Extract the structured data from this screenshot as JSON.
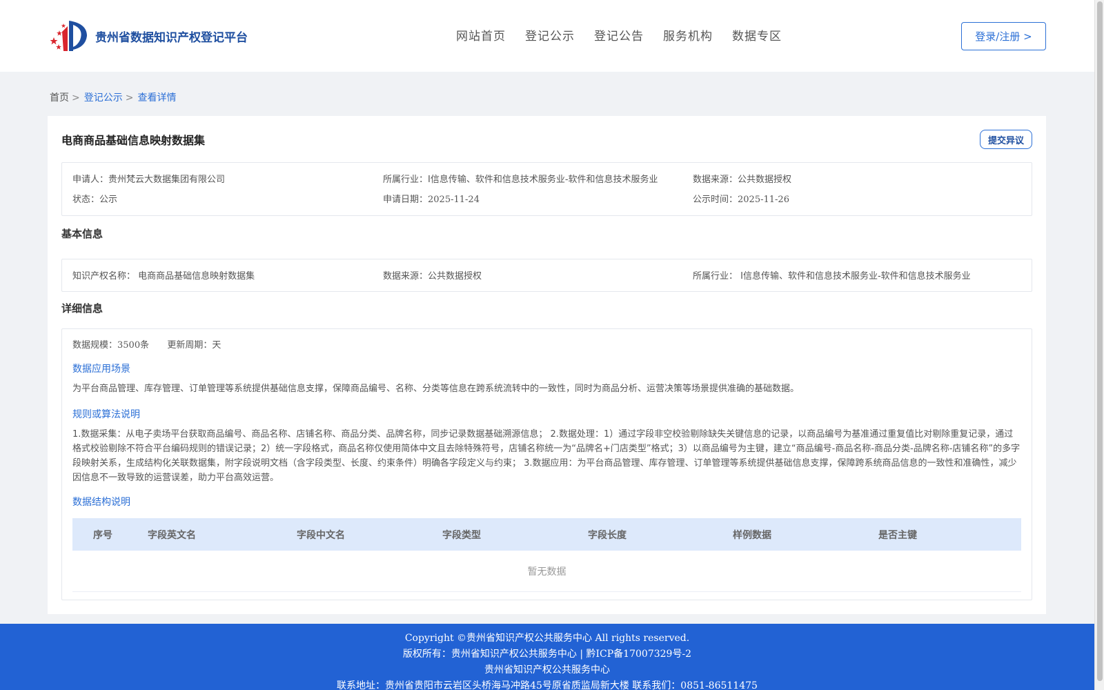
{
  "header": {
    "logo_text": "贵州省数据知识产权登记平台",
    "nav": [
      "网站首页",
      "登记公示",
      "登记公告",
      "服务机构",
      "数据专区"
    ],
    "login_label": "登录/注册 >"
  },
  "breadcrumb": {
    "home": "首页",
    "sep": ">",
    "items": [
      "登记公示",
      "查看详情"
    ]
  },
  "detail": {
    "title": "电商商品基础信息映射数据集",
    "objection_label": "提交异议",
    "summary": {
      "applicant_label": "申请人：",
      "applicant": "贵州梵云大数据集团有限公司",
      "industry_label": "所属行业：",
      "industry": "I信息传输、软件和信息技术服务业-软件和信息技术服务业",
      "source_label": "数据来源：",
      "source": "公共数据授权",
      "status_label": "状态：",
      "status": "公示",
      "apply_date_label": "申请日期：",
      "apply_date": "2025-11-24",
      "publish_label": "公示时间：",
      "publish_date": "2025-11-26"
    },
    "basic": {
      "heading": "基本信息",
      "ip_name_label": "知识产权名称：",
      "ip_name": "电商商品基础信息映射数据集",
      "source_label": "数据来源：",
      "source": "公共数据授权",
      "industry_label": "所属行业：",
      "industry": "I信息传输、软件和信息技术服务业-软件和信息技术服务业"
    },
    "details": {
      "heading": "详细信息",
      "scale_label": "数据规模：",
      "scale": "3500条",
      "cycle_label": "更新周期：",
      "cycle": "天",
      "scenario_heading": "数据应用场景",
      "scenario_text": "为平台商品管理、库存管理、订单管理等系统提供基础信息支撑，保障商品编号、名称、分类等信息在跨系统流转中的一致性，同时为商品分析、运营决策等场景提供准确的基础数据。",
      "rules_heading": "规则或算法说明",
      "rules_text": "1.数据采集：从电子卖场平台获取商品编号、商品名称、店铺名称、商品分类、品牌名称，同步记录数据基础溯源信息； 2.数据处理：1）通过字段非空校验剔除缺失关键信息的记录，以商品编号为基准通过重复值比对剔除重复记录，通过格式校验剔除不符合平台编码规则的错误记录；2）统一字段格式，商品名称仅使用简体中文且去除特殊符号，店铺名称统一为“品牌名+门店类型”格式；3）以商品编号为主键，建立“商品编号-商品名称-商品分类-品牌名称-店铺名称”的多字段映射关系，生成结构化关联数据集，附字段说明文档（含字段类型、长度、约束条件）明确各字段定义与约束； 3.数据应用：为平台商品管理、库存管理、订单管理等系统提供基础信息支撑，保障跨系统商品信息的一致性和准确性，减少因信息不一致导致的运营误差，助力平台高效运营。",
      "structure_heading": "数据结构说明",
      "table_headers": [
        "序号",
        "字段英文名",
        "字段中文名",
        "字段类型",
        "字段长度",
        "样例数据",
        "是否主键"
      ],
      "empty_text": "暂无数据"
    }
  },
  "footer": {
    "line1": "Copyright ©贵州省知识产权公共服务中心 All rights reserved.",
    "line2": "版权所有：贵州省知识产权公共服务中心 | 黔ICP备17007329号-2",
    "line3": "贵州省知识产权公共服务中心",
    "line4": "联系地址：贵州省贵阳市云岩区头桥海马冲路45号原省质监局新大楼 联系我们：0851-86511475"
  },
  "colors": {
    "accent": "#2b6fd6",
    "footer_bg": "#2262d4",
    "table_header_bg": "#dde9fb"
  }
}
